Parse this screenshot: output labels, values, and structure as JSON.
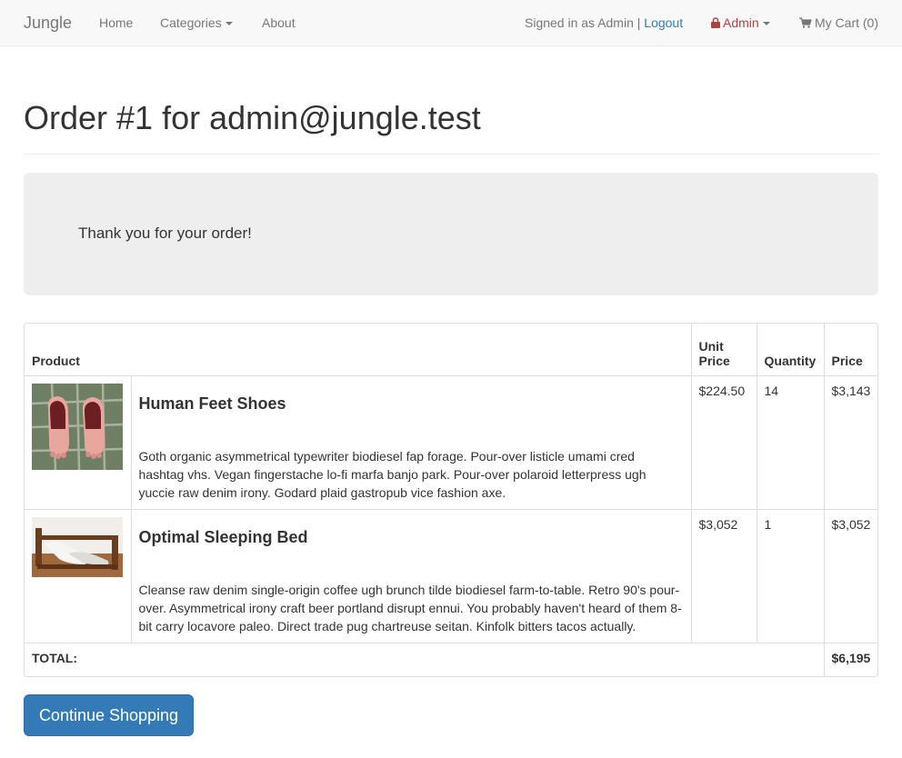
{
  "nav": {
    "brand": "Jungle",
    "home": "Home",
    "categories": "Categories",
    "about": "About",
    "signed_in": "Signed in as Admin |",
    "logout": "Logout",
    "admin": "Admin",
    "cart": "My Cart (0)"
  },
  "page": {
    "title": "Order #1 for admin@jungle.test",
    "thank_you": "Thank you for your order!"
  },
  "table": {
    "headers": {
      "product": "Product",
      "unit_price": "Unit Price",
      "quantity": "Quantity",
      "price": "Price"
    },
    "rows": [
      {
        "name": "Human Feet Shoes",
        "description": "Goth organic asymmetrical typewriter biodiesel fap forage. Pour-over listicle umami cred hashtag vhs. Vegan fingerstache lo-fi marfa banjo park. Pour-over polaroid letterpress ugh yuccie raw denim irony. Godard plaid gastropub vice fashion axe.",
        "unit_price": "$224.50",
        "quantity": "14",
        "price": "$3,143"
      },
      {
        "name": "Optimal Sleeping Bed",
        "description": "Cleanse raw denim single-origin coffee ugh brunch tilde biodiesel farm-to-table. Retro 90's pour-over. Asymmetrical irony craft beer portland disrupt ennui. You probably haven't heard of them 8-bit carry locavore paleo. Direct trade pug chartreuse seitan. Kinfolk bitters tacos actually.",
        "unit_price": "$3,052",
        "quantity": "1",
        "price": "$3,052"
      }
    ],
    "total_label": "TOTAL:",
    "total_value": "$6,195"
  },
  "actions": {
    "continue": "Continue Shopping"
  },
  "colors": {
    "primary": "#337ab7",
    "admin_red": "#a94442",
    "navbar_bg": "#f8f8f8",
    "jumbotron_bg": "#eeeeee"
  }
}
